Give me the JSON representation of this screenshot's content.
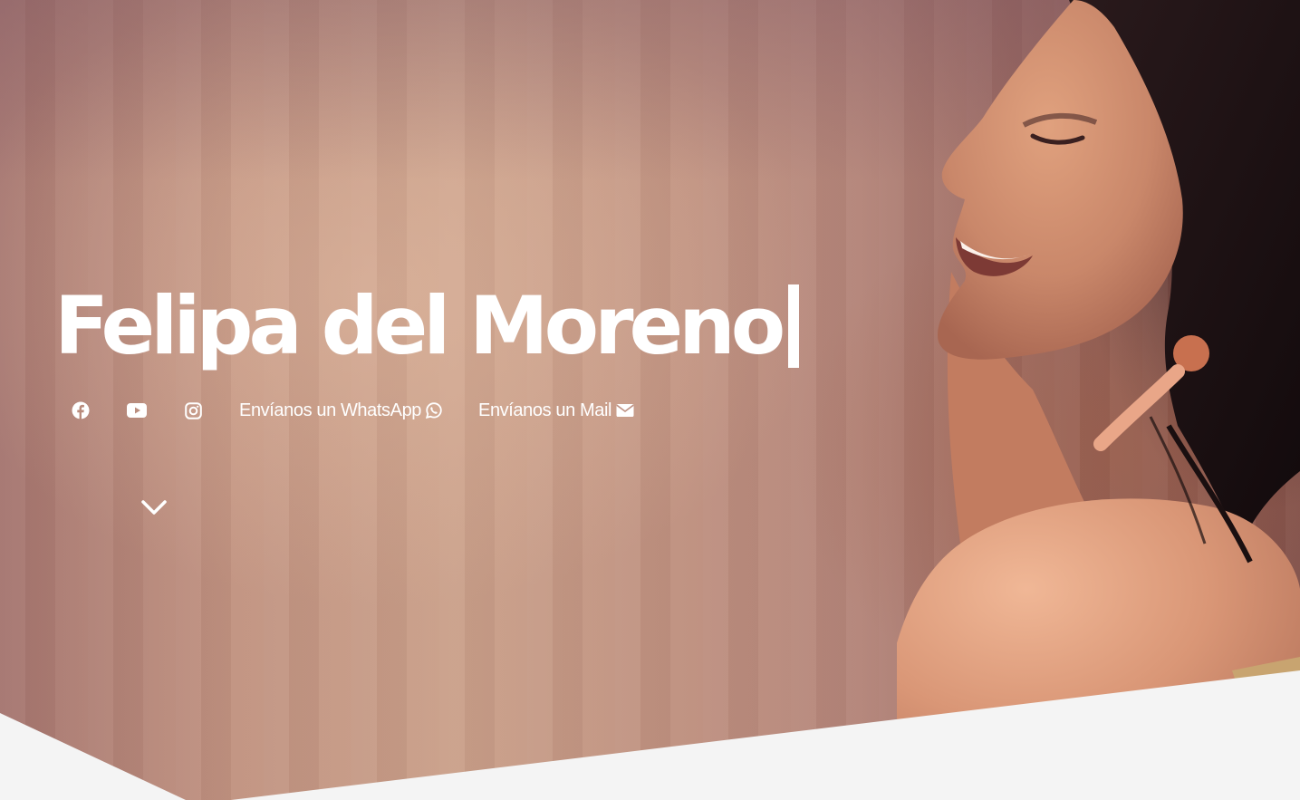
{
  "hero": {
    "title": "Felipa del Moreno",
    "background_image": "portrait-photo"
  },
  "links": {
    "social": [
      {
        "icon": "facebook-icon"
      },
      {
        "icon": "youtube-icon"
      },
      {
        "icon": "instagram-icon"
      }
    ],
    "whatsapp_label": "Envíanos un WhatsApp",
    "whatsapp_icon": "whatsapp-icon",
    "mail_label": "Envíanos un Mail",
    "mail_icon": "envelope-icon"
  },
  "scroll": {
    "icon": "chevron-down-icon"
  },
  "colors": {
    "text": "#ffffff",
    "section_background": "#f4f4f4"
  }
}
